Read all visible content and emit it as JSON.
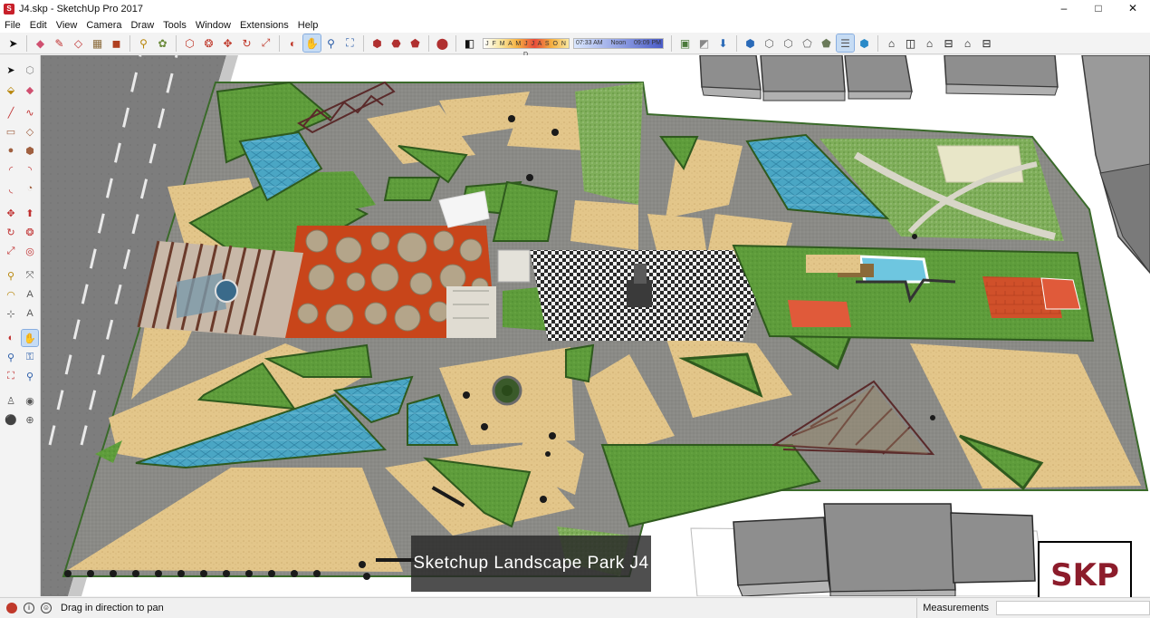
{
  "window": {
    "title": "J4.skp - SketchUp Pro 2017",
    "controls": [
      "–",
      "□",
      "✕"
    ]
  },
  "menu": [
    "File",
    "Edit",
    "View",
    "Camera",
    "Draw",
    "Tools",
    "Window",
    "Extensions",
    "Help"
  ],
  "shadows": {
    "months": "J F M A M J J A S O N D",
    "time_start": "07:33 AM",
    "time_mid": "Noon",
    "time_end": "09:09 PM"
  },
  "status": {
    "hint": "Drag in direction to pan",
    "measurements_label": "Measurements",
    "measurements_value": ""
  },
  "overlay": {
    "caption": "Sketchup Landscape Park J4",
    "logo": "SKP"
  },
  "colors": {
    "sand": "#e6c88a",
    "grass": "#5f9e3a",
    "water": "#4aa8c8",
    "path": "#8a8a8a",
    "brick": "#c84a22"
  }
}
